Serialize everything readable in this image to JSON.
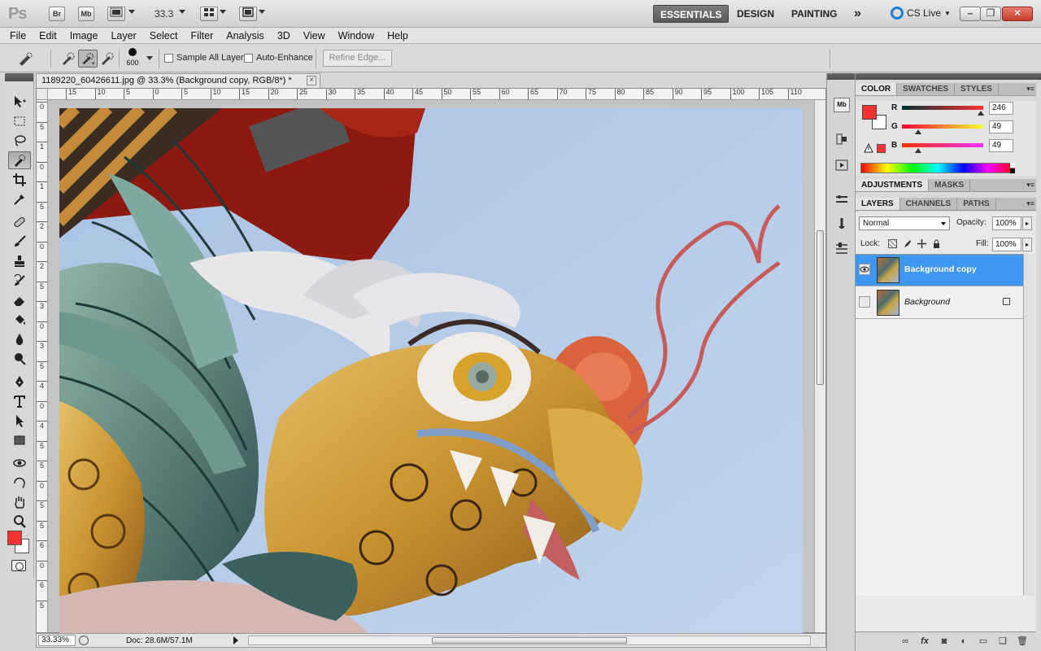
{
  "appbar": {
    "logo": "Ps",
    "bridge_label": "Br",
    "minibridge_label": "Mb",
    "zoom_value": "33.3",
    "workspaces": [
      "ESSENTIALS",
      "DESIGN",
      "PAINTING"
    ],
    "more_label": "»",
    "cslive_label": "CS Live"
  },
  "menu": [
    "File",
    "Edit",
    "Image",
    "Layer",
    "Select",
    "Filter",
    "Analysis",
    "3D",
    "View",
    "Window",
    "Help"
  ],
  "options": {
    "brush_size": "600",
    "sample_all_layers": "Sample All Layers",
    "auto_enhance": "Auto-Enhance",
    "refine_edge": "Refine Edge..."
  },
  "document": {
    "tab_title": "1189220_60426611.jpg @ 33.3% (Background copy, RGB/8*) *",
    "ruler_h": [
      "15",
      "10",
      "5",
      "0",
      "5",
      "10",
      "15",
      "20",
      "25",
      "30",
      "35",
      "40",
      "45",
      "50",
      "55",
      "60",
      "65",
      "70",
      "75",
      "80",
      "85",
      "90",
      "95",
      "100",
      "105",
      "110"
    ],
    "ruler_v": [
      "0",
      "5",
      "1",
      "0",
      "1",
      "5",
      "2",
      "0",
      "2",
      "5",
      "3",
      "0",
      "3",
      "5",
      "4",
      "0",
      "4",
      "5",
      "5",
      "0",
      "5",
      "5",
      "6",
      "0",
      "6",
      "5"
    ]
  },
  "status": {
    "zoom": "33.33%",
    "doc_size": "Doc: 28.6M/57.1M"
  },
  "colors": {
    "foreground": "#f63131",
    "selection_blue": "#3d96f0",
    "active_workspace": "#5e5e5e"
  },
  "color_panel": {
    "tabs": [
      "COLOR",
      "SWATCHES",
      "STYLES"
    ],
    "r_label": "R",
    "g_label": "G",
    "b_label": "B",
    "r": "246",
    "g": "49",
    "b": "49"
  },
  "adjustments_tabs": [
    "ADJUSTMENTS",
    "MASKS"
  ],
  "layers_panel": {
    "tabs": [
      "LAYERS",
      "CHANNELS",
      "PATHS"
    ],
    "blend_mode": "Normal",
    "opacity_label": "Opacity:",
    "opacity": "100%",
    "lock_label": "Lock:",
    "fill_label": "Fill:",
    "fill": "100%",
    "layers": [
      {
        "name": "Background copy",
        "selected": true
      },
      {
        "name": "Background",
        "selected": false
      }
    ]
  }
}
